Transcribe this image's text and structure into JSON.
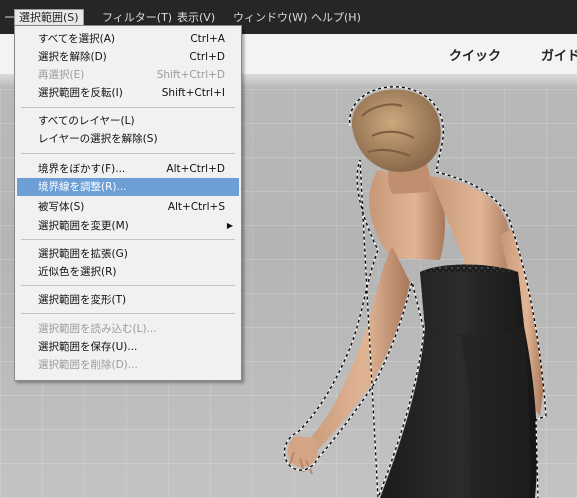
{
  "menubar": {
    "items": [
      {
        "label": "ー(L)"
      },
      {
        "label": "選択範囲(S)"
      },
      {
        "label": "フィルター(T)"
      },
      {
        "label": "表示(V)"
      },
      {
        "label": "ウィンドウ(W)"
      },
      {
        "label": "ヘルプ(H)"
      }
    ]
  },
  "toolbar": {
    "tabs": [
      {
        "label": "クイック"
      },
      {
        "label": "ガイド"
      }
    ]
  },
  "dropdown": {
    "items": [
      {
        "label": "すべてを選択(A)",
        "shortcut": "Ctrl+A",
        "enabled": true
      },
      {
        "label": "選択を解除(D)",
        "shortcut": "Ctrl+D",
        "enabled": true
      },
      {
        "label": "再選択(E)",
        "shortcut": "Shift+Ctrl+D",
        "enabled": false
      },
      {
        "label": "選択範囲を反転(I)",
        "shortcut": "Shift+Ctrl+I",
        "enabled": true
      },
      {
        "label": "すべてのレイヤー(L)",
        "shortcut": "",
        "enabled": true
      },
      {
        "label": "レイヤーの選択を解除(S)",
        "shortcut": "",
        "enabled": true
      },
      {
        "label": "境界をぼかす(F)...",
        "shortcut": "Alt+Ctrl+D",
        "enabled": true
      },
      {
        "label": "境界線を調整(R)...",
        "shortcut": "",
        "enabled": true,
        "highlighted": true
      },
      {
        "label": "被写体(S)",
        "shortcut": "Alt+Ctrl+S",
        "enabled": true
      },
      {
        "label": "選択範囲を変更(M)",
        "shortcut": "",
        "enabled": true,
        "submenu": true
      },
      {
        "label": "選択範囲を拡張(G)",
        "shortcut": "",
        "enabled": true
      },
      {
        "label": "近似色を選択(R)",
        "shortcut": "",
        "enabled": true
      },
      {
        "label": "選択範囲を変形(T)",
        "shortcut": "",
        "enabled": true
      },
      {
        "label": "選択範囲を読み込む(L)...",
        "shortcut": "",
        "enabled": false
      },
      {
        "label": "選択範囲を保存(U)...",
        "shortcut": "",
        "enabled": true
      },
      {
        "label": "選択範囲を削除(D)...",
        "shortcut": "",
        "enabled": false
      }
    ]
  },
  "colors": {
    "highlight": "#6d9fd6",
    "menu_bg": "#f1f1f1",
    "menubar_bg": "#262626",
    "canvas_bg": "#b9b9b9"
  }
}
